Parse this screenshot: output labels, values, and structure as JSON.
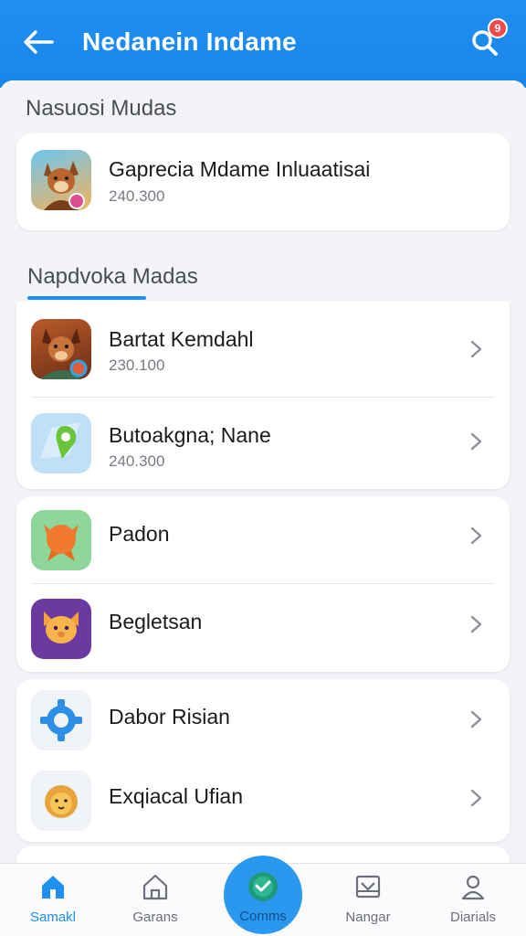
{
  "app": {
    "title": "Nedanein Indame",
    "notification_count": "9"
  },
  "sections": {
    "featured_title": "Nasuosi Mudas",
    "list_title": "Napdvoka Madas"
  },
  "featured": {
    "name": "Gaprecia Mdame Inluaatisai",
    "sub": "240.300"
  },
  "list": [
    {
      "name": "Bartat Kemdahl",
      "sub": "230.100"
    },
    {
      "name": "Butoakgna; Nane",
      "sub": "240.300"
    }
  ],
  "group2": [
    {
      "name": "Padon"
    },
    {
      "name": "Begletsan"
    }
  ],
  "group3": [
    {
      "name": "Dabor Risian"
    },
    {
      "name": "Exqiacal Ufian"
    }
  ],
  "nav": [
    {
      "label": "Samakl",
      "icon": "home-icon"
    },
    {
      "label": "Garans",
      "icon": "house-outline-icon"
    },
    {
      "label": "Comms",
      "icon": "check-circle-icon"
    },
    {
      "label": "Nangar",
      "icon": "inbox-icon"
    },
    {
      "label": "Diarials",
      "icon": "person-icon"
    }
  ],
  "colors": {
    "appbar": "#1f8ff0",
    "accent": "#1f8ff0",
    "background": "#f3f4f8"
  }
}
